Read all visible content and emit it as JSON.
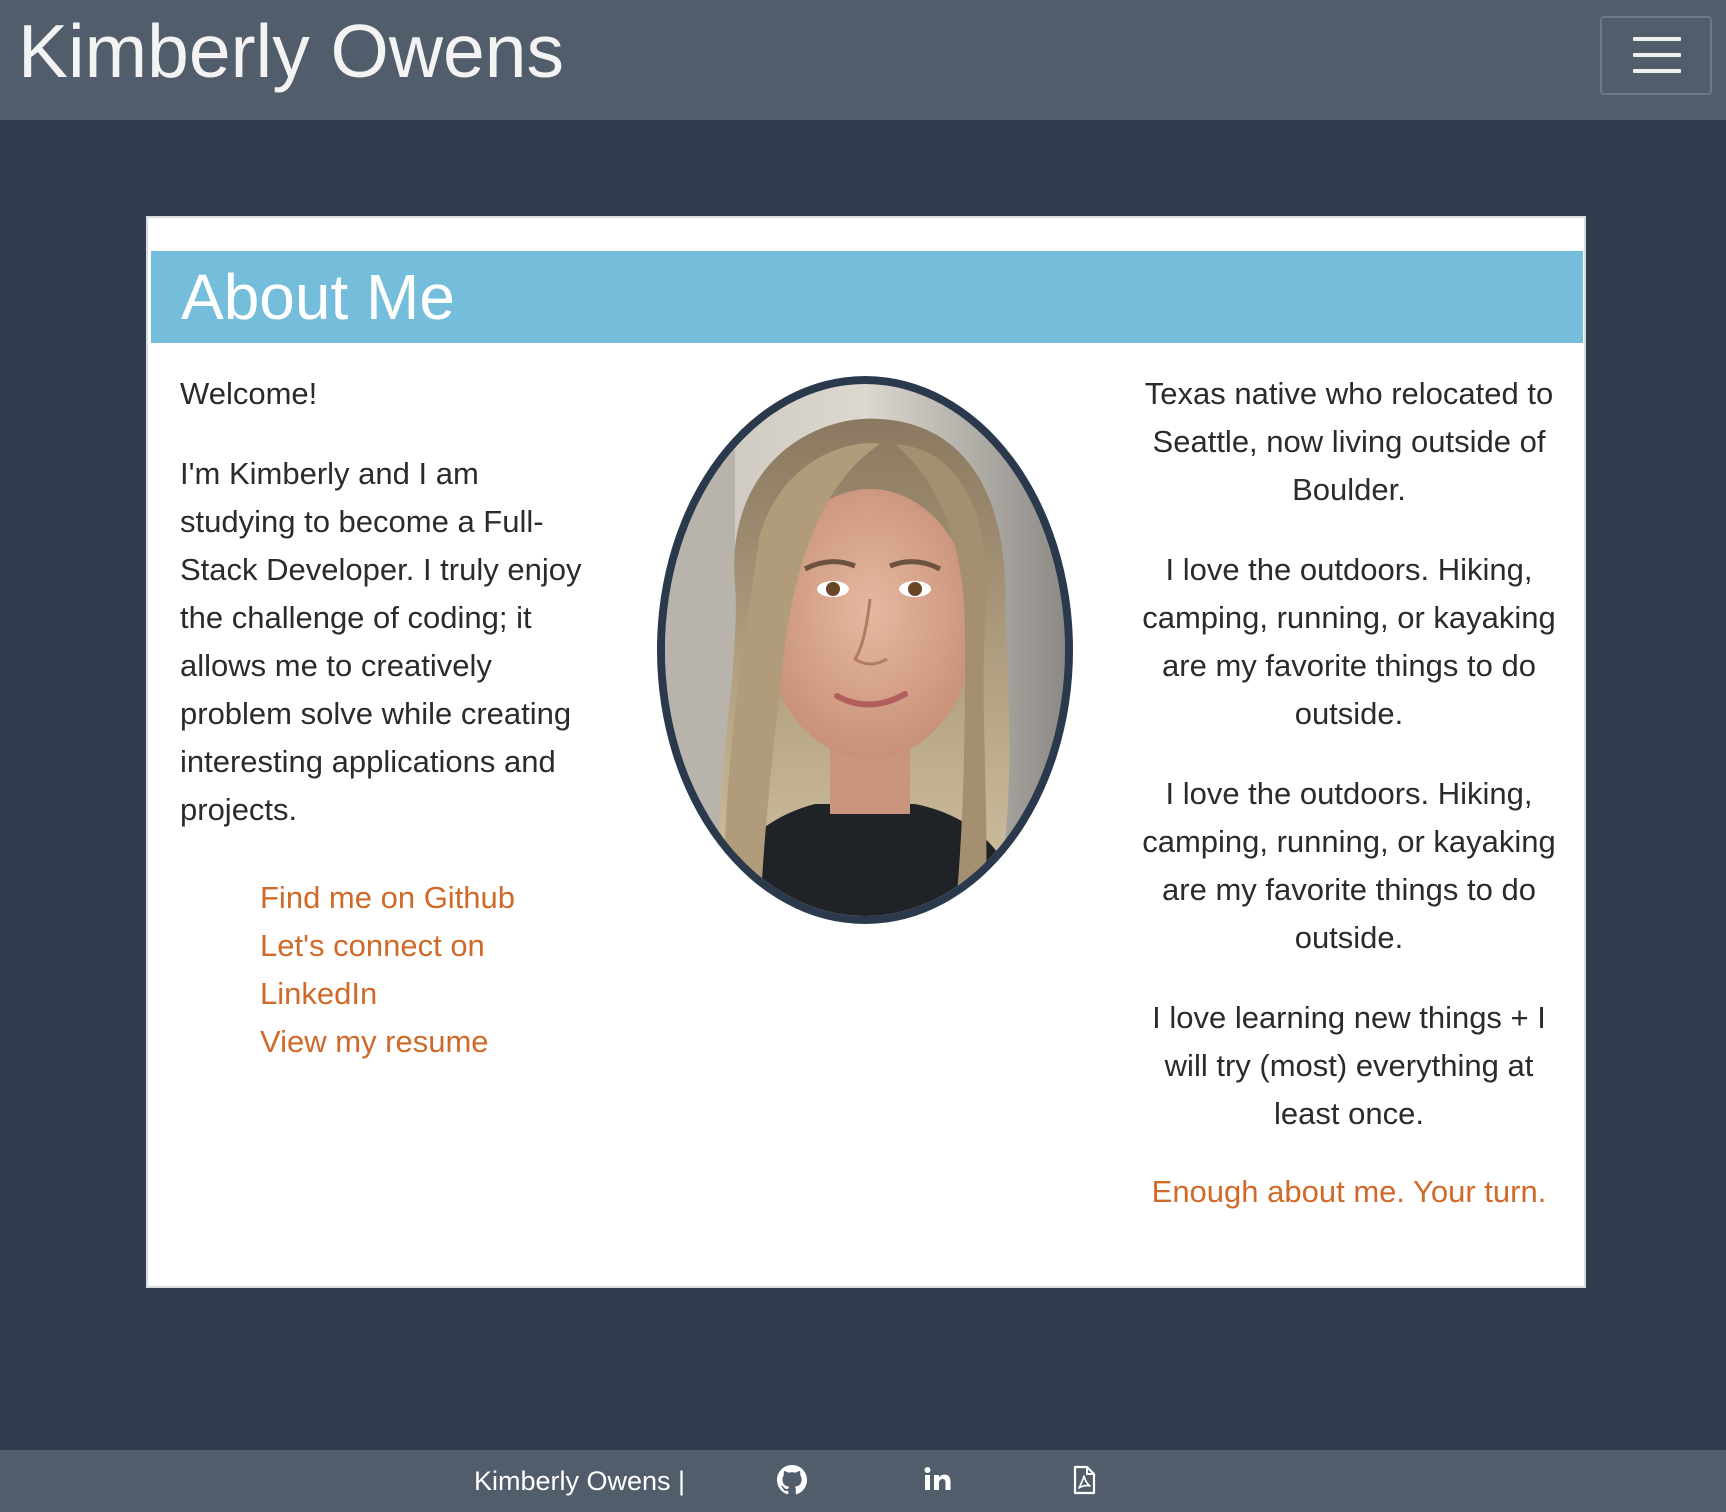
{
  "navbar": {
    "brand": "Kimberly Owens",
    "menu_icon": "hamburger-menu-icon"
  },
  "about": {
    "title": "About Me",
    "welcome": "Welcome!",
    "intro": "I'm Kimberly and I am studying to become a Full-Stack Developer. I truly enjoy the challenge of coding; it allows me to creatively problem solve while creating interesting applications and projects.",
    "links": {
      "github": "Find me on Github",
      "linkedin": "Let's connect on LinkedIn",
      "resume": "View my resume"
    },
    "right": [
      "Texas native who relocated to Seattle, now living outside of Boulder.",
      "I love the outdoors. Hiking, camping, running, or kayaking are my favorite things to do outside.",
      "I love the outdoors. Hiking, camping, running, or kayaking are my favorite things to do outside.",
      "I love learning new things + I will try (most) everything at least once."
    ],
    "your_turn": "Enough about me. Your turn."
  },
  "footer": {
    "name": "Kimberly Owens |",
    "icons": [
      "github-icon",
      "linkedin-icon",
      "pdf-file-icon"
    ]
  },
  "colors": {
    "page_bg": "#313d4f",
    "nav_bg": "#525d6c",
    "header_accent": "#74bedc",
    "link": "#d06a2a"
  }
}
